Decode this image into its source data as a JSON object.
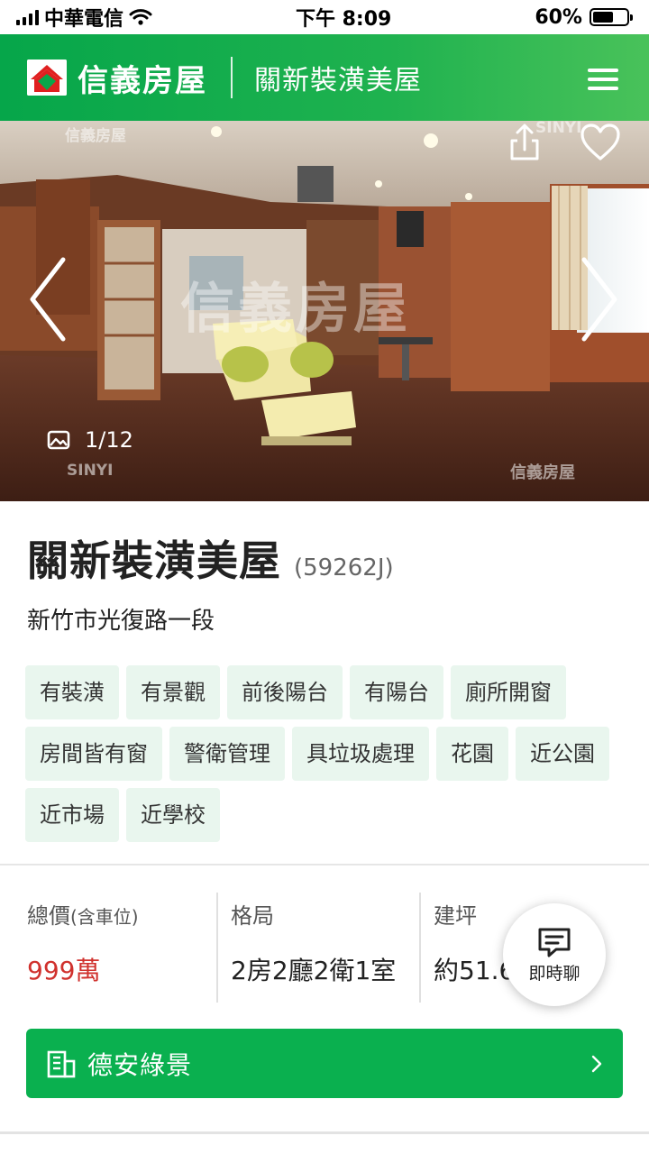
{
  "status_bar": {
    "carrier": "中華電信",
    "time": "下午 8:09",
    "battery_percent": "60%",
    "battery_level": 0.6
  },
  "header": {
    "brand": "信義房屋",
    "title": "關新裝潢美屋",
    "menu_icon": "hamburger-menu-icon"
  },
  "gallery": {
    "counter": "1/12",
    "watermark_big": "信義房屋",
    "watermark_small_1": "信義房屋",
    "watermark_small_2": "SINYI",
    "watermark_small_3": "SINYI",
    "watermark_small_4": "信義房屋",
    "icons": [
      "share-icon",
      "heart-icon",
      "chevron-left-icon",
      "chevron-right-icon",
      "image-icon"
    ]
  },
  "listing": {
    "title": "關新裝潢美屋",
    "code": "(59262J)",
    "address": "新竹市光復路一段",
    "tags": [
      "有裝潢",
      "有景觀",
      "前後陽台",
      "有陽台",
      "廁所開窗",
      "房間皆有窗",
      "警衛管理",
      "具垃圾處理",
      "花園",
      "近公園",
      "近市場",
      "近學校"
    ]
  },
  "stats": {
    "price_label": "總價",
    "price_label_note": "(含車位)",
    "price_value": "999萬",
    "layout_label": "格局",
    "layout_value": "2房2廳2衛1室",
    "area_label": "建坪",
    "area_value": "約51.66坪"
  },
  "chat": {
    "label": "即時聊"
  },
  "community": {
    "name": "德安綠景"
  },
  "colors": {
    "brand_green": "#0ab04f",
    "tag_bg": "#e9f6ee",
    "price_red": "#d0312d"
  }
}
